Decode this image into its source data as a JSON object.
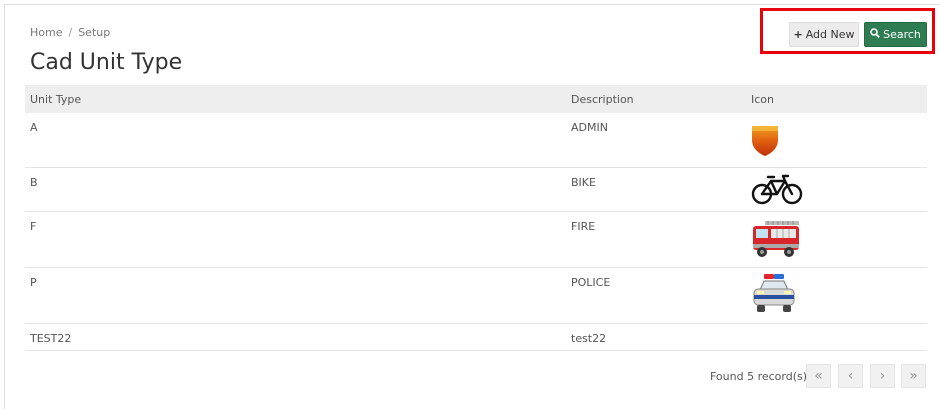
{
  "breadcrumb": {
    "home": "Home",
    "separator": "/",
    "current": "Setup"
  },
  "page_title": "Cad Unit Type",
  "toolbar": {
    "add_icon": "plus-icon",
    "add_glyph": "+",
    "add_label": "Add New",
    "search_icon": "magnifier-icon",
    "search_glyph": "🔍",
    "search_label": "Search",
    "highlight_color": "#e8000b",
    "search_color": "#2e7d52"
  },
  "table": {
    "headers": {
      "unit_type": "Unit Type",
      "description": "Description",
      "icon": "Icon"
    },
    "rows": [
      {
        "unit_type": "A",
        "description": "ADMIN",
        "icon": "shield-icon"
      },
      {
        "unit_type": "B",
        "description": "BIKE",
        "icon": "bicycle-icon"
      },
      {
        "unit_type": "F",
        "description": "FIRE",
        "icon": "fire-truck-icon"
      },
      {
        "unit_type": "P",
        "description": "POLICE",
        "icon": "police-car-icon"
      },
      {
        "unit_type": "TEST22",
        "description": "test22",
        "icon": ""
      }
    ]
  },
  "footer": {
    "records_text": "Found 5 record(s)",
    "pager": {
      "first": "«",
      "prev": "‹",
      "next": "›",
      "last": "»"
    }
  }
}
